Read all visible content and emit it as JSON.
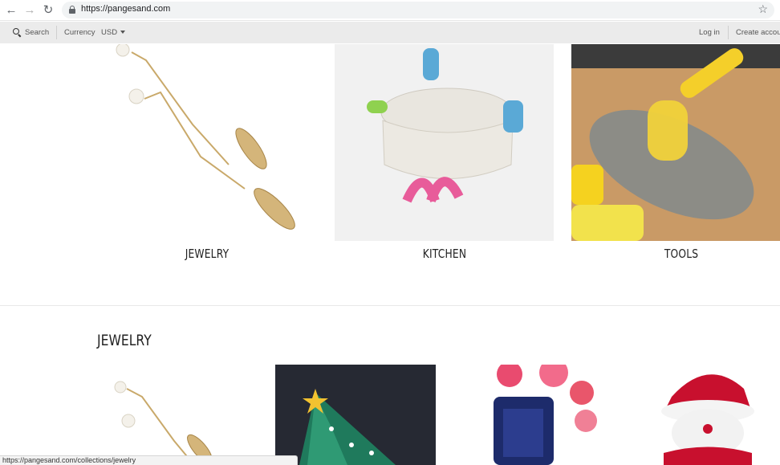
{
  "browser": {
    "url": "https://pangesand.com",
    "status_url": "https://pangesand.com/collections/jewelry"
  },
  "topbar": {
    "search_label": "Search",
    "currency_label": "Currency",
    "currency_value": "USD",
    "login_label": "Log in",
    "create_account_label": "Create accou"
  },
  "collections": [
    {
      "label": "JEWELRY"
    },
    {
      "label": "KITCHEN"
    },
    {
      "label": "TOOLS"
    }
  ],
  "section": {
    "title": "JEWELRY"
  },
  "colors": {
    "topbar_bg": "#ebebeb",
    "text": "#222222"
  }
}
